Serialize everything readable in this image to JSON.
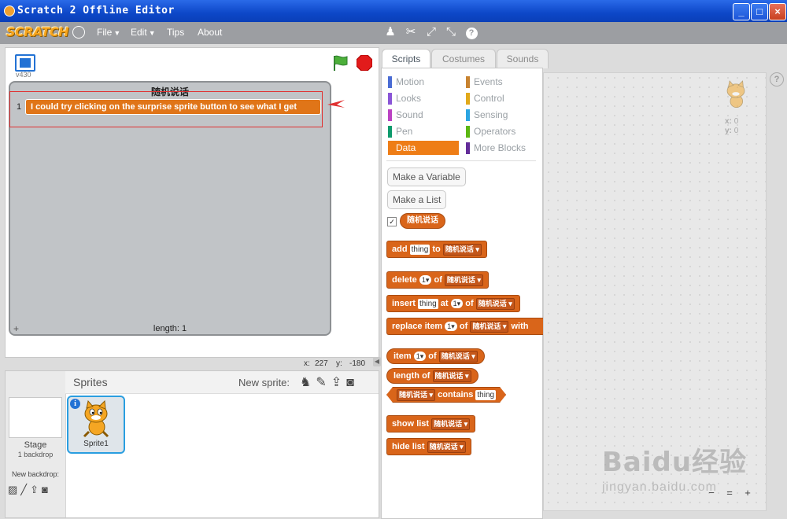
{
  "window": {
    "title": "Scratch 2 Offline Editor"
  },
  "menubar": {
    "logo": "SCRATCH",
    "items": [
      {
        "label": "File"
      },
      {
        "label": "Edit"
      },
      {
        "label": "Tips"
      },
      {
        "label": "About"
      }
    ],
    "tool_icons": [
      "duplicate-icon",
      "cut-icon",
      "grow-icon",
      "shrink-icon",
      "help-icon"
    ]
  },
  "stage": {
    "version": "v430",
    "list_monitor": {
      "title": "随机说话",
      "items": [
        {
          "index": "1",
          "text": "I could try clicking on the surprise sprite button to see what I get"
        }
      ],
      "length_label": "length: 1",
      "add_label": "+"
    },
    "coords": {
      "x_label": "x:",
      "x_value": "227",
      "y_label": "y:",
      "y_value": "-180"
    }
  },
  "sprites": {
    "header": "Sprites",
    "new_sprite_label": "New sprite:",
    "stage": {
      "label": "Stage",
      "sub": "1 backdrop"
    },
    "new_backdrop_label": "New backdrop:",
    "items": [
      {
        "name": "Sprite1"
      }
    ]
  },
  "tabs": [
    {
      "label": "Scripts",
      "active": true
    },
    {
      "label": "Costumes",
      "active": false
    },
    {
      "label": "Sounds",
      "active": false
    }
  ],
  "categories": [
    {
      "label": "Motion",
      "color": "#4a6cd4"
    },
    {
      "label": "Events",
      "color": "#c88330"
    },
    {
      "label": "Looks",
      "color": "#8a55d7"
    },
    {
      "label": "Control",
      "color": "#e1a91a"
    },
    {
      "label": "Sound",
      "color": "#bb42c3"
    },
    {
      "label": "Sensing",
      "color": "#2ca5e2"
    },
    {
      "label": "Pen",
      "color": "#0e9a6c"
    },
    {
      "label": "Operators",
      "color": "#5cb712"
    },
    {
      "label": "Data",
      "color": "#ee7d16"
    },
    {
      "label": "More Blocks",
      "color": "#632d99"
    }
  ],
  "palette": {
    "make_variable": "Make a Variable",
    "make_list": "Make a List",
    "list_name": "随机说话",
    "blocks": {
      "add": {
        "w1": "add",
        "v1": "thing",
        "w2": "to",
        "list": "随机说话"
      },
      "delete": {
        "w1": "delete",
        "n": "1",
        "w2": "of",
        "list": "随机说话"
      },
      "insert": {
        "w1": "insert",
        "v1": "thing",
        "w2": "at",
        "n": "1",
        "w3": "of",
        "list": "随机说话"
      },
      "replace": {
        "w1": "replace",
        "w2": "item",
        "n": "1",
        "w3": "of",
        "list": "随机说话",
        "w4": "with"
      },
      "item": {
        "w1": "item",
        "n": "1",
        "w2": "of",
        "list": "随机说话"
      },
      "length": {
        "w1": "length",
        "w2": "of",
        "list": "随机说话"
      },
      "contains": {
        "list": "随机说话",
        "w1": "contains",
        "v1": "thing"
      },
      "show": {
        "w1": "show",
        "w2": "list",
        "list": "随机说话"
      },
      "hide": {
        "w1": "hide",
        "w2": "list",
        "list": "随机说话"
      }
    }
  },
  "script_area": {
    "sprite_x_label": "x:",
    "sprite_x": "0",
    "sprite_y_label": "y:",
    "sprite_y": "0",
    "zoom_out": "−",
    "zoom_reset": "=",
    "zoom_in": "+"
  },
  "watermark": {
    "text1": "Baidu经验",
    "text2": "jingyan.baidu.com"
  },
  "colors": {
    "data_block": "#d9651a",
    "active_category": "#ee7d16",
    "selection_blue": "#2a9ee0",
    "annotation_red": "#e03030"
  }
}
